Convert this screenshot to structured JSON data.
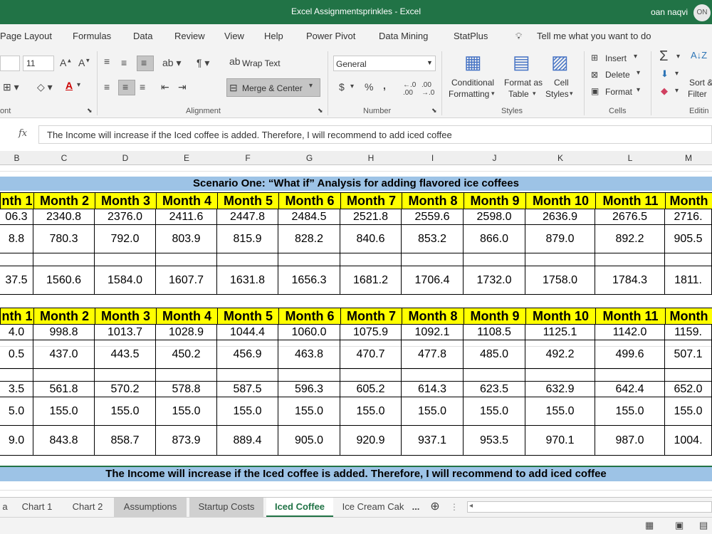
{
  "window": {
    "title": "Excel Assignmentsprinkles  -  Excel",
    "user": "oan naqvi",
    "avatar": "ON"
  },
  "menu": [
    "Page Layout",
    "Formulas",
    "Data",
    "Review",
    "View",
    "Help",
    "Power Pivot",
    "Data Mining",
    "StatPlus"
  ],
  "tell_me": "Tell me what you want to do",
  "ribbon": {
    "font_size": "11",
    "wrap_text": "Wrap Text",
    "merge_center": "Merge & Center",
    "number_format": "General",
    "currency": "$",
    "percent": "%",
    "comma": ",",
    "conditional_1": "Conditional",
    "conditional_2": "Formatting",
    "format_as_1": "Format as",
    "format_as_2": "Table",
    "cell_styles_1": "Cell",
    "cell_styles_2": "Styles",
    "insert": "Insert",
    "delete": "Delete",
    "format": "Format",
    "sort_1": "Sort &",
    "sort_2": "Filter",
    "groups": {
      "font": "ont",
      "alignment": "Alignment",
      "number": "Number",
      "styles": "Styles",
      "cells": "Cells",
      "editing": "Editin"
    }
  },
  "formula_bar": {
    "fx": "fx",
    "content": "The Income will increase if the Iced coffee is added. Therefore, I will recommend to add iced coffee"
  },
  "columns": [
    "B",
    "C",
    "D",
    "E",
    "F",
    "G",
    "H",
    "I",
    "J",
    "K",
    "L",
    "M"
  ],
  "banner": "Scenario One: “What if” Analysis for adding flavored ice coffees",
  "header_top": [
    "nth 1",
    "Month 2",
    "Month 3",
    "Month 4",
    "Month 5",
    "Month 6",
    "Month 7",
    "Month 8",
    "Month 9",
    "Month 10",
    "Month 11",
    "Month"
  ],
  "block1": [
    [
      "06.3",
      "2340.8",
      "2376.0",
      "2411.6",
      "2447.8",
      "2484.5",
      "2521.8",
      "2559.6",
      "2598.0",
      "2636.9",
      "2676.5",
      "2716."
    ],
    [
      "8.8",
      "780.3",
      "792.0",
      "803.9",
      "815.9",
      "828.2",
      "840.6",
      "853.2",
      "866.0",
      "879.0",
      "892.2",
      "905.5"
    ],
    [
      "",
      "",
      "",
      "",
      "",
      "",
      "",
      "",
      "",
      "",
      "",
      ""
    ],
    [
      "37.5",
      "1560.6",
      "1584.0",
      "1607.7",
      "1631.8",
      "1656.3",
      "1681.2",
      "1706.4",
      "1732.0",
      "1758.0",
      "1784.3",
      "1811."
    ]
  ],
  "header_bottom": [
    "nth 1",
    "Month 2",
    "Month 3",
    "Month 4",
    "Month 5",
    "Month 6",
    "Month 7",
    "Month 8",
    "Month 9",
    "Month 10",
    "Month 11",
    "Month"
  ],
  "block2": [
    [
      "4.0",
      "998.8",
      "1013.7",
      "1028.9",
      "1044.4",
      "1060.0",
      "1075.9",
      "1092.1",
      "1108.5",
      "1125.1",
      "1142.0",
      "1159."
    ],
    [
      "0.5",
      "437.0",
      "443.5",
      "450.2",
      "456.9",
      "463.8",
      "470.7",
      "477.8",
      "485.0",
      "492.2",
      "499.6",
      "507.1"
    ],
    [
      "",
      "",
      "",
      "",
      "",
      "",
      "",
      "",
      "",
      "",
      "",
      ""
    ],
    [
      "3.5",
      "561.8",
      "570.2",
      "578.8",
      "587.5",
      "596.3",
      "605.2",
      "614.3",
      "623.5",
      "632.9",
      "642.4",
      "652.0"
    ],
    [
      "5.0",
      "155.0",
      "155.0",
      "155.0",
      "155.0",
      "155.0",
      "155.0",
      "155.0",
      "155.0",
      "155.0",
      "155.0",
      "155.0"
    ],
    [
      "9.0",
      "843.8",
      "858.7",
      "873.9",
      "889.4",
      "905.0",
      "920.9",
      "937.1",
      "953.5",
      "970.1",
      "987.0",
      "1004."
    ]
  ],
  "conclusion": "The Income will increase if the Iced coffee is added. Therefore, I will recommend to add iced coffee",
  "tabs": [
    "a",
    "Chart 1",
    "Chart 2",
    "Assumptions",
    "Startup Costs",
    "Iced Coffee",
    "Ice Cream Cak",
    "..."
  ]
}
